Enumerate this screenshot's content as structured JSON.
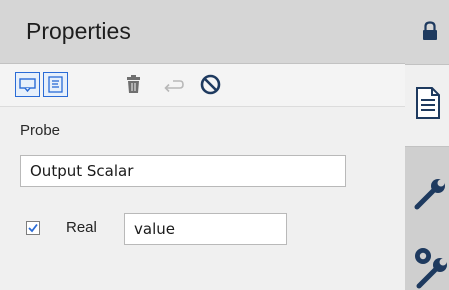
{
  "panel": {
    "title": "Properties",
    "toolbar": {
      "buttons": [
        {
          "name": "input-view",
          "icon": "input-field-icon",
          "active": true
        },
        {
          "name": "text-view",
          "icon": "text-lines-icon",
          "active": true
        },
        {
          "name": "delete",
          "icon": "trash-icon",
          "active": false
        },
        {
          "name": "undo",
          "icon": "undo-arrow-icon",
          "active": false
        },
        {
          "name": "disable",
          "icon": "prohibit-icon",
          "active": false
        }
      ]
    },
    "section_label": "Probe",
    "output_field": {
      "value": "Output Scalar"
    },
    "real": {
      "checked": true,
      "label": "Real",
      "value": "value"
    }
  },
  "rail": {
    "tabs": [
      {
        "icon": "lock-icon"
      },
      {
        "icon": "document-icon",
        "selected": true
      },
      {
        "icon": "wrench-icon"
      },
      {
        "icon": "wrench-gear-icon"
      }
    ]
  },
  "colors": {
    "accent": "#2a6bd6",
    "header_bg": "#d6d6d6",
    "panel_bg": "#f0f0f0",
    "rail_bg": "#cfcfcf",
    "icon_dark": "#1e3a5f",
    "icon_gray": "#6f6f6f"
  }
}
